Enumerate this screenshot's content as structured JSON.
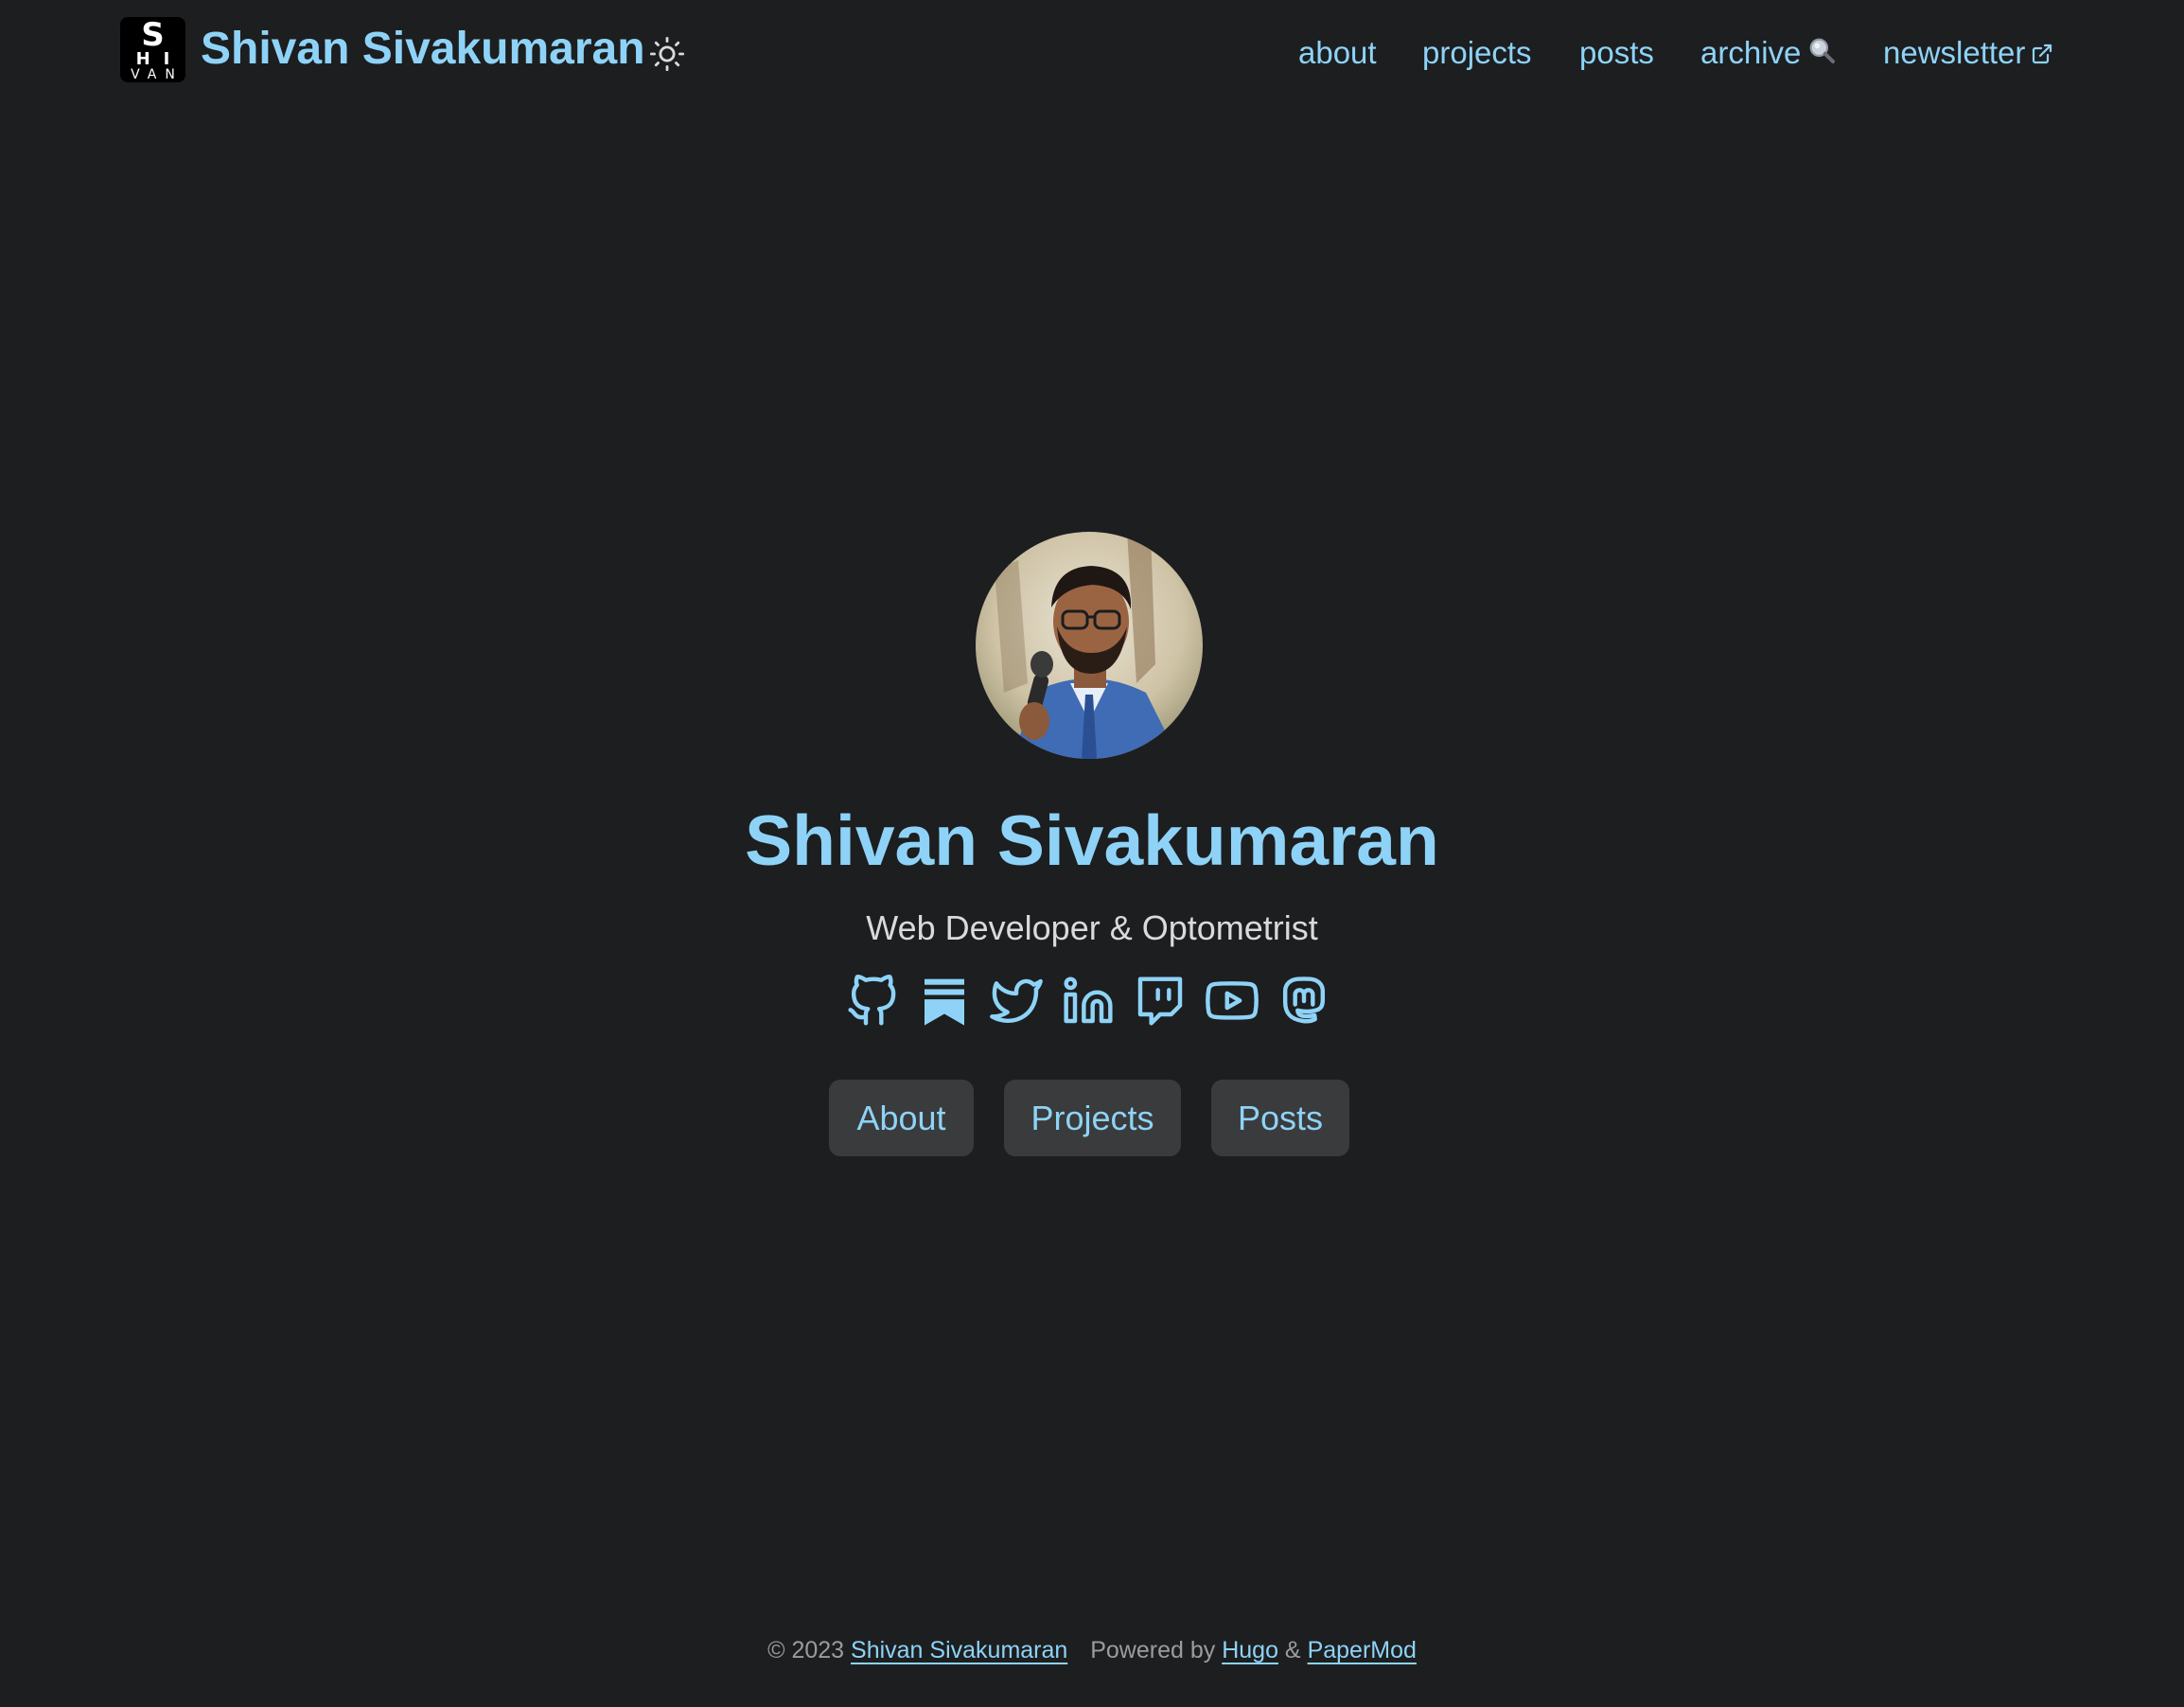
{
  "header": {
    "logo_lines": [
      "S",
      "HI",
      "VAN"
    ],
    "site_title": "Shivan Sivakumaran",
    "theme_toggle_icon": "sun-icon",
    "nav": [
      {
        "label": "about"
      },
      {
        "label": "projects"
      },
      {
        "label": "posts"
      },
      {
        "label": "archive",
        "icon": "search-icon"
      },
      {
        "label": "newsletter",
        "icon": "external-link-icon"
      }
    ]
  },
  "profile": {
    "name": "Shivan Sivakumaran",
    "subtitle": "Web Developer & Optometrist",
    "social": [
      {
        "icon": "github-icon"
      },
      {
        "icon": "substack-icon"
      },
      {
        "icon": "twitter-icon"
      },
      {
        "icon": "linkedin-icon"
      },
      {
        "icon": "twitch-icon"
      },
      {
        "icon": "youtube-icon"
      },
      {
        "icon": "mastodon-icon"
      }
    ],
    "buttons": [
      {
        "label": "About"
      },
      {
        "label": "Projects"
      },
      {
        "label": "Posts"
      }
    ]
  },
  "footer": {
    "copyright": "© 2023",
    "author": "Shivan Sivakumaran",
    "powered_by": "Powered by",
    "hugo": "Hugo",
    "amp": "&",
    "papermod": "PaperMod"
  },
  "colors": {
    "background": "#1d1e20",
    "accent": "#8ed3f7",
    "button_bg": "#3a3b3c",
    "text": "#dadadb",
    "muted": "#9b9c9d"
  }
}
